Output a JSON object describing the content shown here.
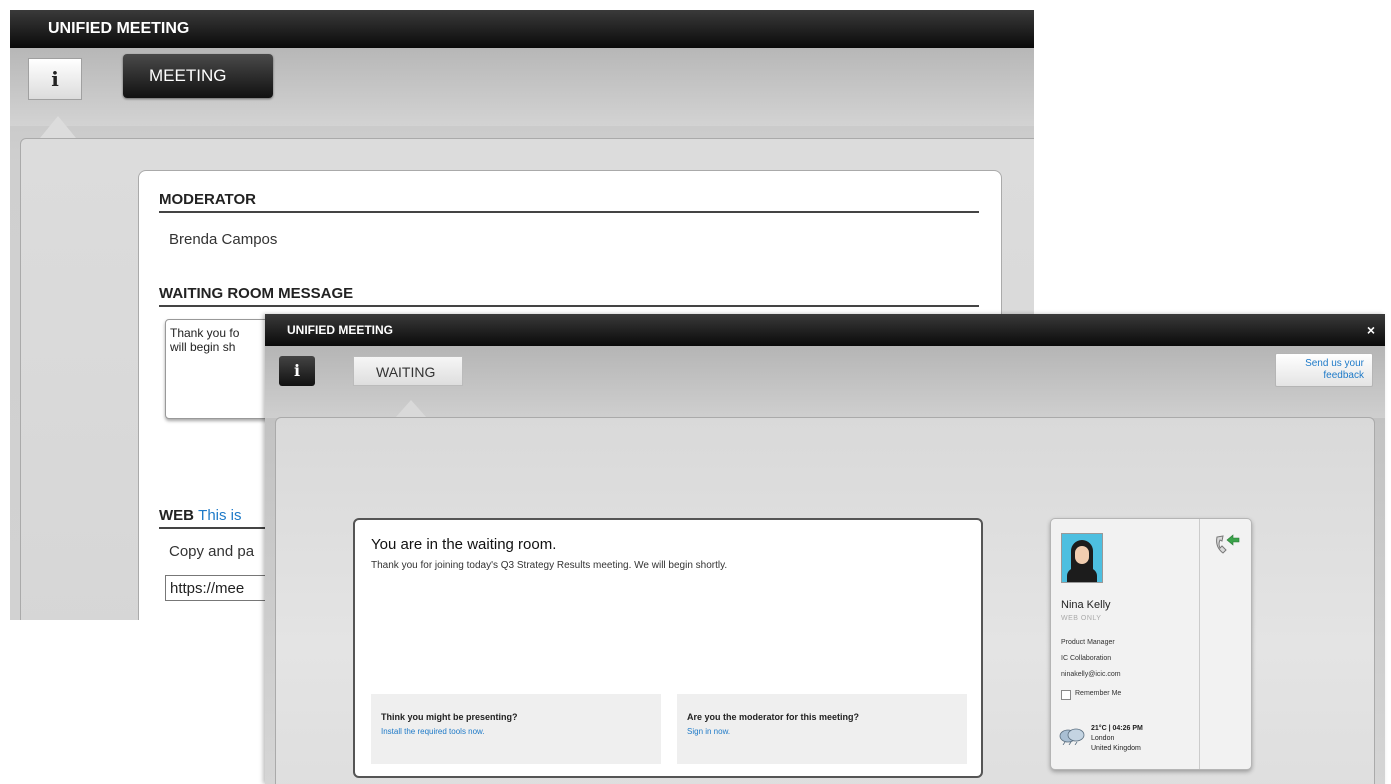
{
  "back_window": {
    "title": "UNIFIED MEETING",
    "info_label": "i",
    "tab_label": "MEETING",
    "moderator_heading": "MODERATOR",
    "moderator_name": "Brenda Campos",
    "waiting_heading": "WAITING ROOM MESSAGE",
    "message_line1": "Thank you fo",
    "message_line2": "will begin sh",
    "web_heading": "WEB",
    "web_link": "This is",
    "copy_text": "Copy and pa",
    "url_value": "https://mee"
  },
  "front_window": {
    "title": "UNIFIED MEETING",
    "close_label": "×",
    "info_label": "i",
    "tab_label": "WAITING",
    "feedback_line1": "Send us your",
    "feedback_line2": "feedback",
    "waiting": {
      "title": "You are in the waiting room.",
      "message": "Thank you for joining today's Q3 Strategy Results meeting. We will begin shortly.",
      "presenting_question": "Think you might be presenting?",
      "presenting_link": "Install the required tools now.",
      "moderator_question": "Are you the moderator for this meeting?",
      "moderator_link": "Sign in now."
    },
    "profile": {
      "name": "Nina Kelly",
      "mode": "WEB ONLY",
      "role": "Product Manager",
      "company": "IC Collaboration",
      "email": "ninakelly@icic.com",
      "remember": "Remember Me",
      "weather": "21°C | 04:26 PM",
      "city": "London",
      "country": "United Kingdom"
    }
  }
}
